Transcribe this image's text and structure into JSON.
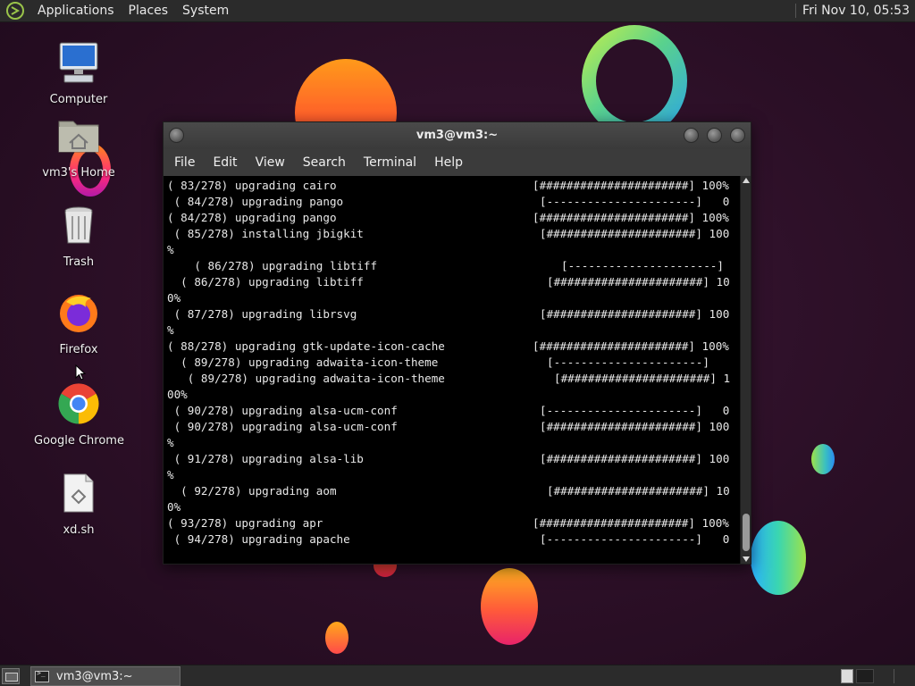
{
  "top_panel": {
    "menus": [
      "Applications",
      "Places",
      "System"
    ],
    "clock": "Fri Nov 10, 05:53"
  },
  "desktop_icons": [
    {
      "label": "Computer",
      "icon": "computer-icon"
    },
    {
      "label": "vm3's Home",
      "icon": "home-folder-icon"
    },
    {
      "label": "Trash",
      "icon": "trash-icon"
    },
    {
      "label": "Firefox",
      "icon": "firefox-icon"
    },
    {
      "label": "Google Chrome",
      "icon": "chrome-icon"
    },
    {
      "label": "xd.sh",
      "icon": "script-file-icon"
    }
  ],
  "window": {
    "title": "vm3@vm3:~",
    "menu": [
      "File",
      "Edit",
      "View",
      "Search",
      "Terminal",
      "Help"
    ]
  },
  "terminal": {
    "lines": [
      {
        "l": "( 83/278) upgrading cairo",
        "r": "[######################] 100%"
      },
      {
        "l": " ( 84/278) upgrading pango",
        "r": "[----------------------]   0"
      },
      {
        "l": "( 84/278) upgrading pango",
        "r": "[######################] 100%"
      },
      {
        "l": " ( 85/278) installing jbigkit",
        "r": "[######################] 100"
      },
      {
        "l": "%",
        "r": ""
      },
      {
        "l": "    ( 86/278) upgrading libtiff",
        "r": "[----------------------]"
      },
      {
        "l": "  ( 86/278) upgrading libtiff",
        "r": "[######################] 10"
      },
      {
        "l": "0%",
        "r": ""
      },
      {
        "l": " ( 87/278) upgrading librsvg",
        "r": "[######################] 100"
      },
      {
        "l": "%",
        "r": ""
      },
      {
        "l": "( 88/278) upgrading gtk-update-icon-cache",
        "r": "[######################] 100%"
      },
      {
        "l": "  ( 89/278) upgrading adwaita-icon-theme",
        "r": "[----------------------]"
      },
      {
        "l": "   ( 89/278) upgrading adwaita-icon-theme",
        "r": "[######################] 1"
      },
      {
        "l": "00%",
        "r": ""
      },
      {
        "l": " ( 90/278) upgrading alsa-ucm-conf",
        "r": "[----------------------]   0"
      },
      {
        "l": " ( 90/278) upgrading alsa-ucm-conf",
        "r": "[######################] 100"
      },
      {
        "l": "%",
        "r": ""
      },
      {
        "l": " ( 91/278) upgrading alsa-lib",
        "r": "[######################] 100"
      },
      {
        "l": "%",
        "r": ""
      },
      {
        "l": "  ( 92/278) upgrading aom",
        "r": "[######################] 10"
      },
      {
        "l": "0%",
        "r": ""
      },
      {
        "l": "( 93/278) upgrading apr",
        "r": "[######################] 100%"
      },
      {
        "l": " ( 94/278) upgrading apache",
        "r": "[----------------------]   0"
      }
    ]
  },
  "taskbar": {
    "task_label": "vm3@vm3:~"
  }
}
